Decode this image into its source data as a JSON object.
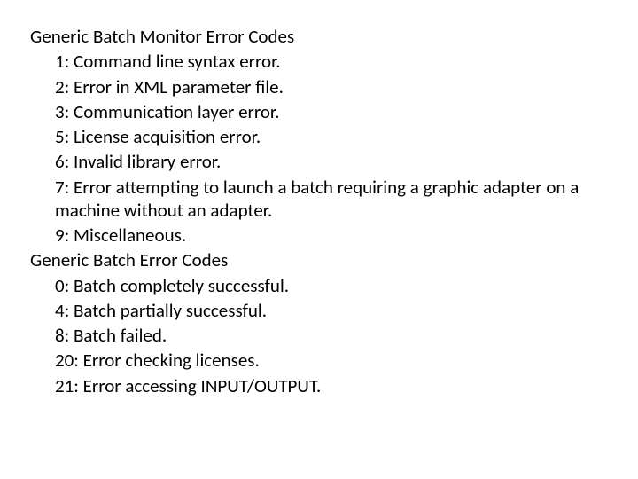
{
  "sections": [
    {
      "heading": "Generic Batch Monitor Error Codes",
      "items": [
        "1: Command line syntax error.",
        "2: Error in XML parameter file.",
        "3: Communication layer error.",
        "5: License acquisition error.",
        "6: Invalid library error.",
        "7: Error attempting to launch a batch requiring a graphic adapter on a machine without an adapter.",
        "9: Miscellaneous."
      ]
    },
    {
      "heading": "Generic Batch Error Codes",
      "items": [
        "0: Batch completely successful.",
        "4: Batch partially successful.",
        "8: Batch failed.",
        "20: Error checking licenses.",
        "21: Error accessing INPUT/OUTPUT."
      ]
    }
  ]
}
